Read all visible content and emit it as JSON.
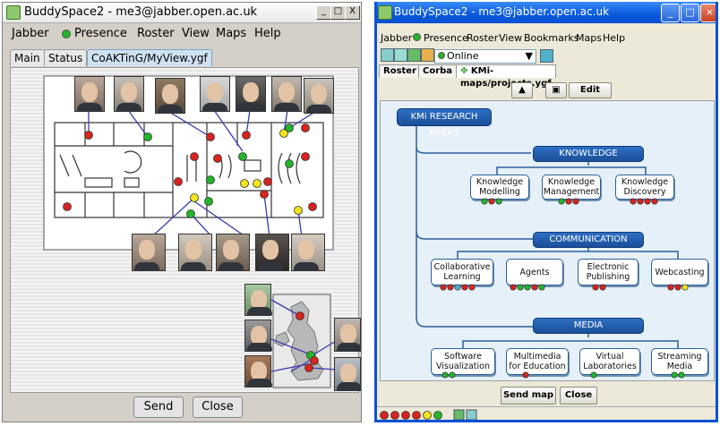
{
  "left_window": {
    "title": "BuddySpace2 - me3@jabber.open.ac.uk",
    "controls": {
      "minimize": "_",
      "maximize": "□",
      "close": "X"
    },
    "menu": [
      "Jabber",
      "Presence",
      "Roster",
      "View",
      "Maps",
      "Help"
    ],
    "tabs": [
      "Main",
      "Status",
      "CoAKTinG/MyView.ygf"
    ],
    "buttons": {
      "send": "Send",
      "close": "Close"
    }
  },
  "right_window": {
    "title": "BuddySpace2 - me3@jabber.open.ac.uk",
    "menu": [
      "Jabber",
      "Presence",
      "Roster",
      "View",
      "Bookmarks",
      "Maps",
      "Help"
    ],
    "status_select": "Online",
    "tabs": [
      "Roster",
      "Corba",
      "KMi-maps/projects.ygf"
    ],
    "edit_button": "Edit",
    "map": {
      "root": "KMi RESEARCH AREAS",
      "sections": [
        {
          "title": "KNOWLEDGE",
          "items": [
            "Knowledge Modelling",
            "Knowledge Management",
            "Knowledge Discovery"
          ]
        },
        {
          "title": "COMMUNICATION",
          "items": [
            "Collaborative Learning",
            "Agents",
            "Electronic Publishing",
            "Webcasting"
          ]
        },
        {
          "title": "MEDIA",
          "items": [
            "Software Visualization",
            "Multimedia for Education",
            "Virtual Laboratories",
            "Streaming Media"
          ]
        }
      ]
    },
    "buttons": {
      "send_map": "Send map",
      "close": "Close"
    }
  },
  "colors": {
    "online": "#22b52a",
    "offline": "#d8231e",
    "away": "#f2e31a",
    "xp_title": "#0a51d6",
    "node_border": "#2a5f9a"
  }
}
